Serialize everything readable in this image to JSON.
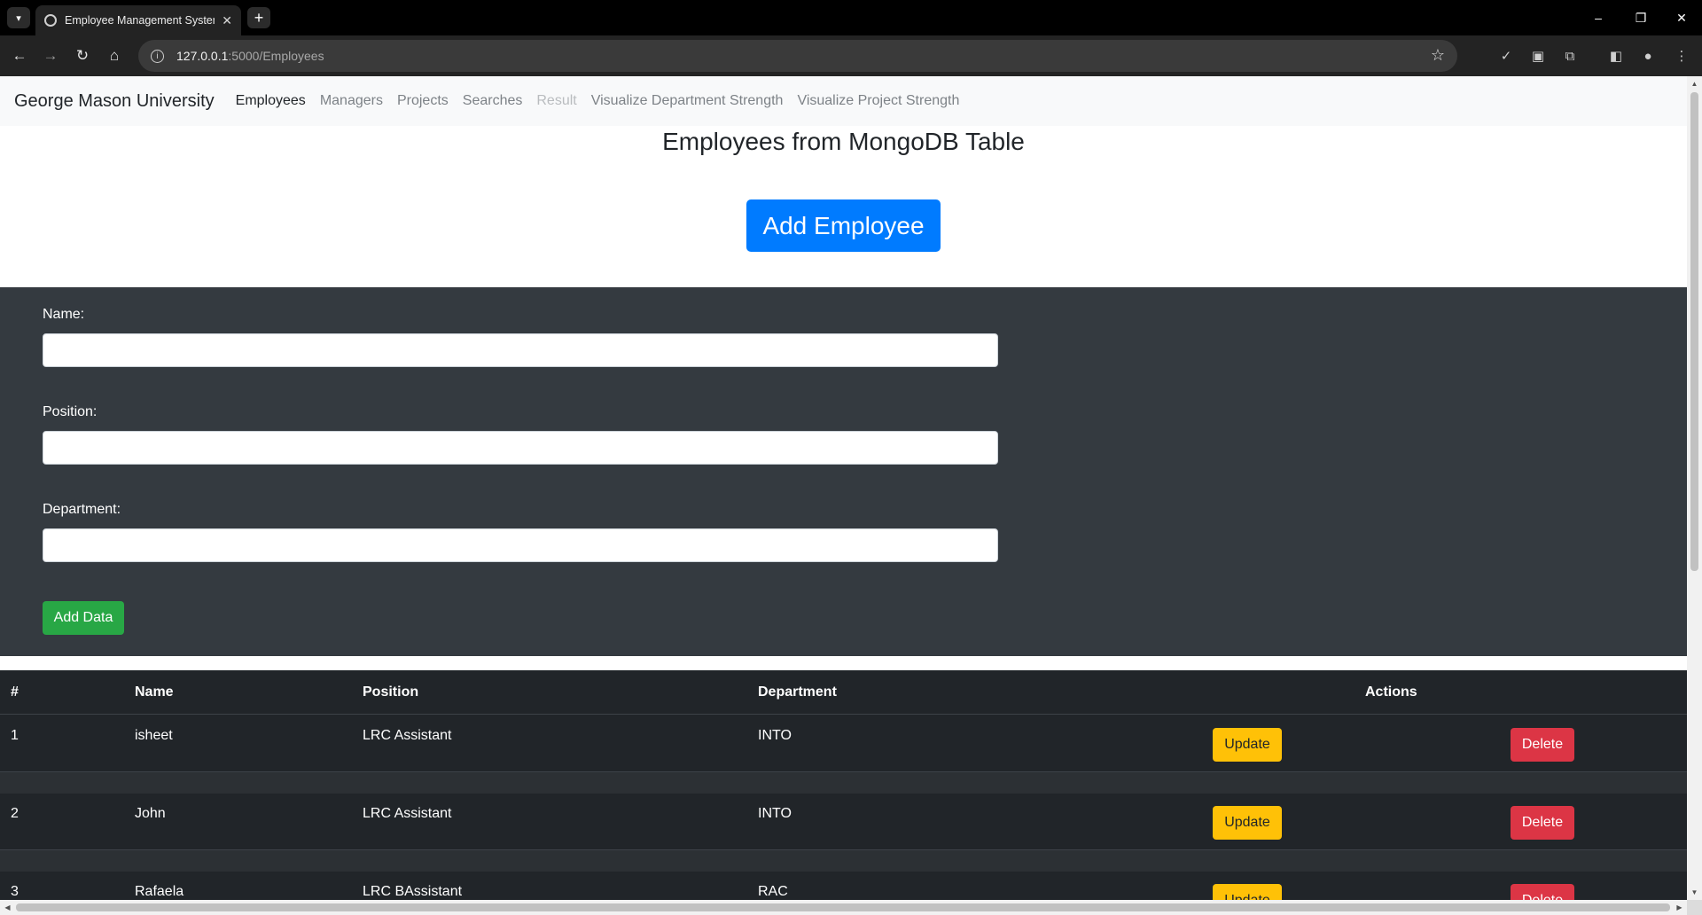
{
  "browser": {
    "tab_title": "Employee Management System",
    "url_host": "127.0.0.1",
    "url_path": ":5000/Employees"
  },
  "navbar": {
    "brand": "George Mason University",
    "links": [
      {
        "label": "Employees",
        "state": "active"
      },
      {
        "label": "Managers",
        "state": "normal"
      },
      {
        "label": "Projects",
        "state": "normal"
      },
      {
        "label": "Searches",
        "state": "normal"
      },
      {
        "label": "Result",
        "state": "disabled"
      },
      {
        "label": "Visualize Department Strength",
        "state": "normal"
      },
      {
        "label": "Visualize Project Strength",
        "state": "normal"
      }
    ]
  },
  "page": {
    "title": "Employees from MongoDB Table",
    "add_employee_label": "Add Employee"
  },
  "form": {
    "name_label": "Name:",
    "name_value": "",
    "position_label": "Position:",
    "position_value": "",
    "department_label": "Department:",
    "department_value": "",
    "submit_label": "Add Data"
  },
  "table": {
    "headers": {
      "index": "#",
      "name": "Name",
      "position": "Position",
      "department": "Department",
      "actions": "Actions"
    },
    "update_label": "Update",
    "delete_label": "Delete",
    "rows": [
      {
        "index": "1",
        "name": "isheet",
        "position": "LRC Assistant",
        "department": "INTO"
      },
      {
        "index": "2",
        "name": "John",
        "position": "LRC Assistant",
        "department": "INTO"
      },
      {
        "index": "3",
        "name": "Rafaela",
        "position": "LRC BAssistant",
        "department": "RAC"
      }
    ]
  },
  "colors": {
    "primary": "#007bff",
    "success": "#28a745",
    "warning": "#ffc107",
    "danger": "#dc3545",
    "dark": "#343a40",
    "table_dark": "#212529"
  }
}
